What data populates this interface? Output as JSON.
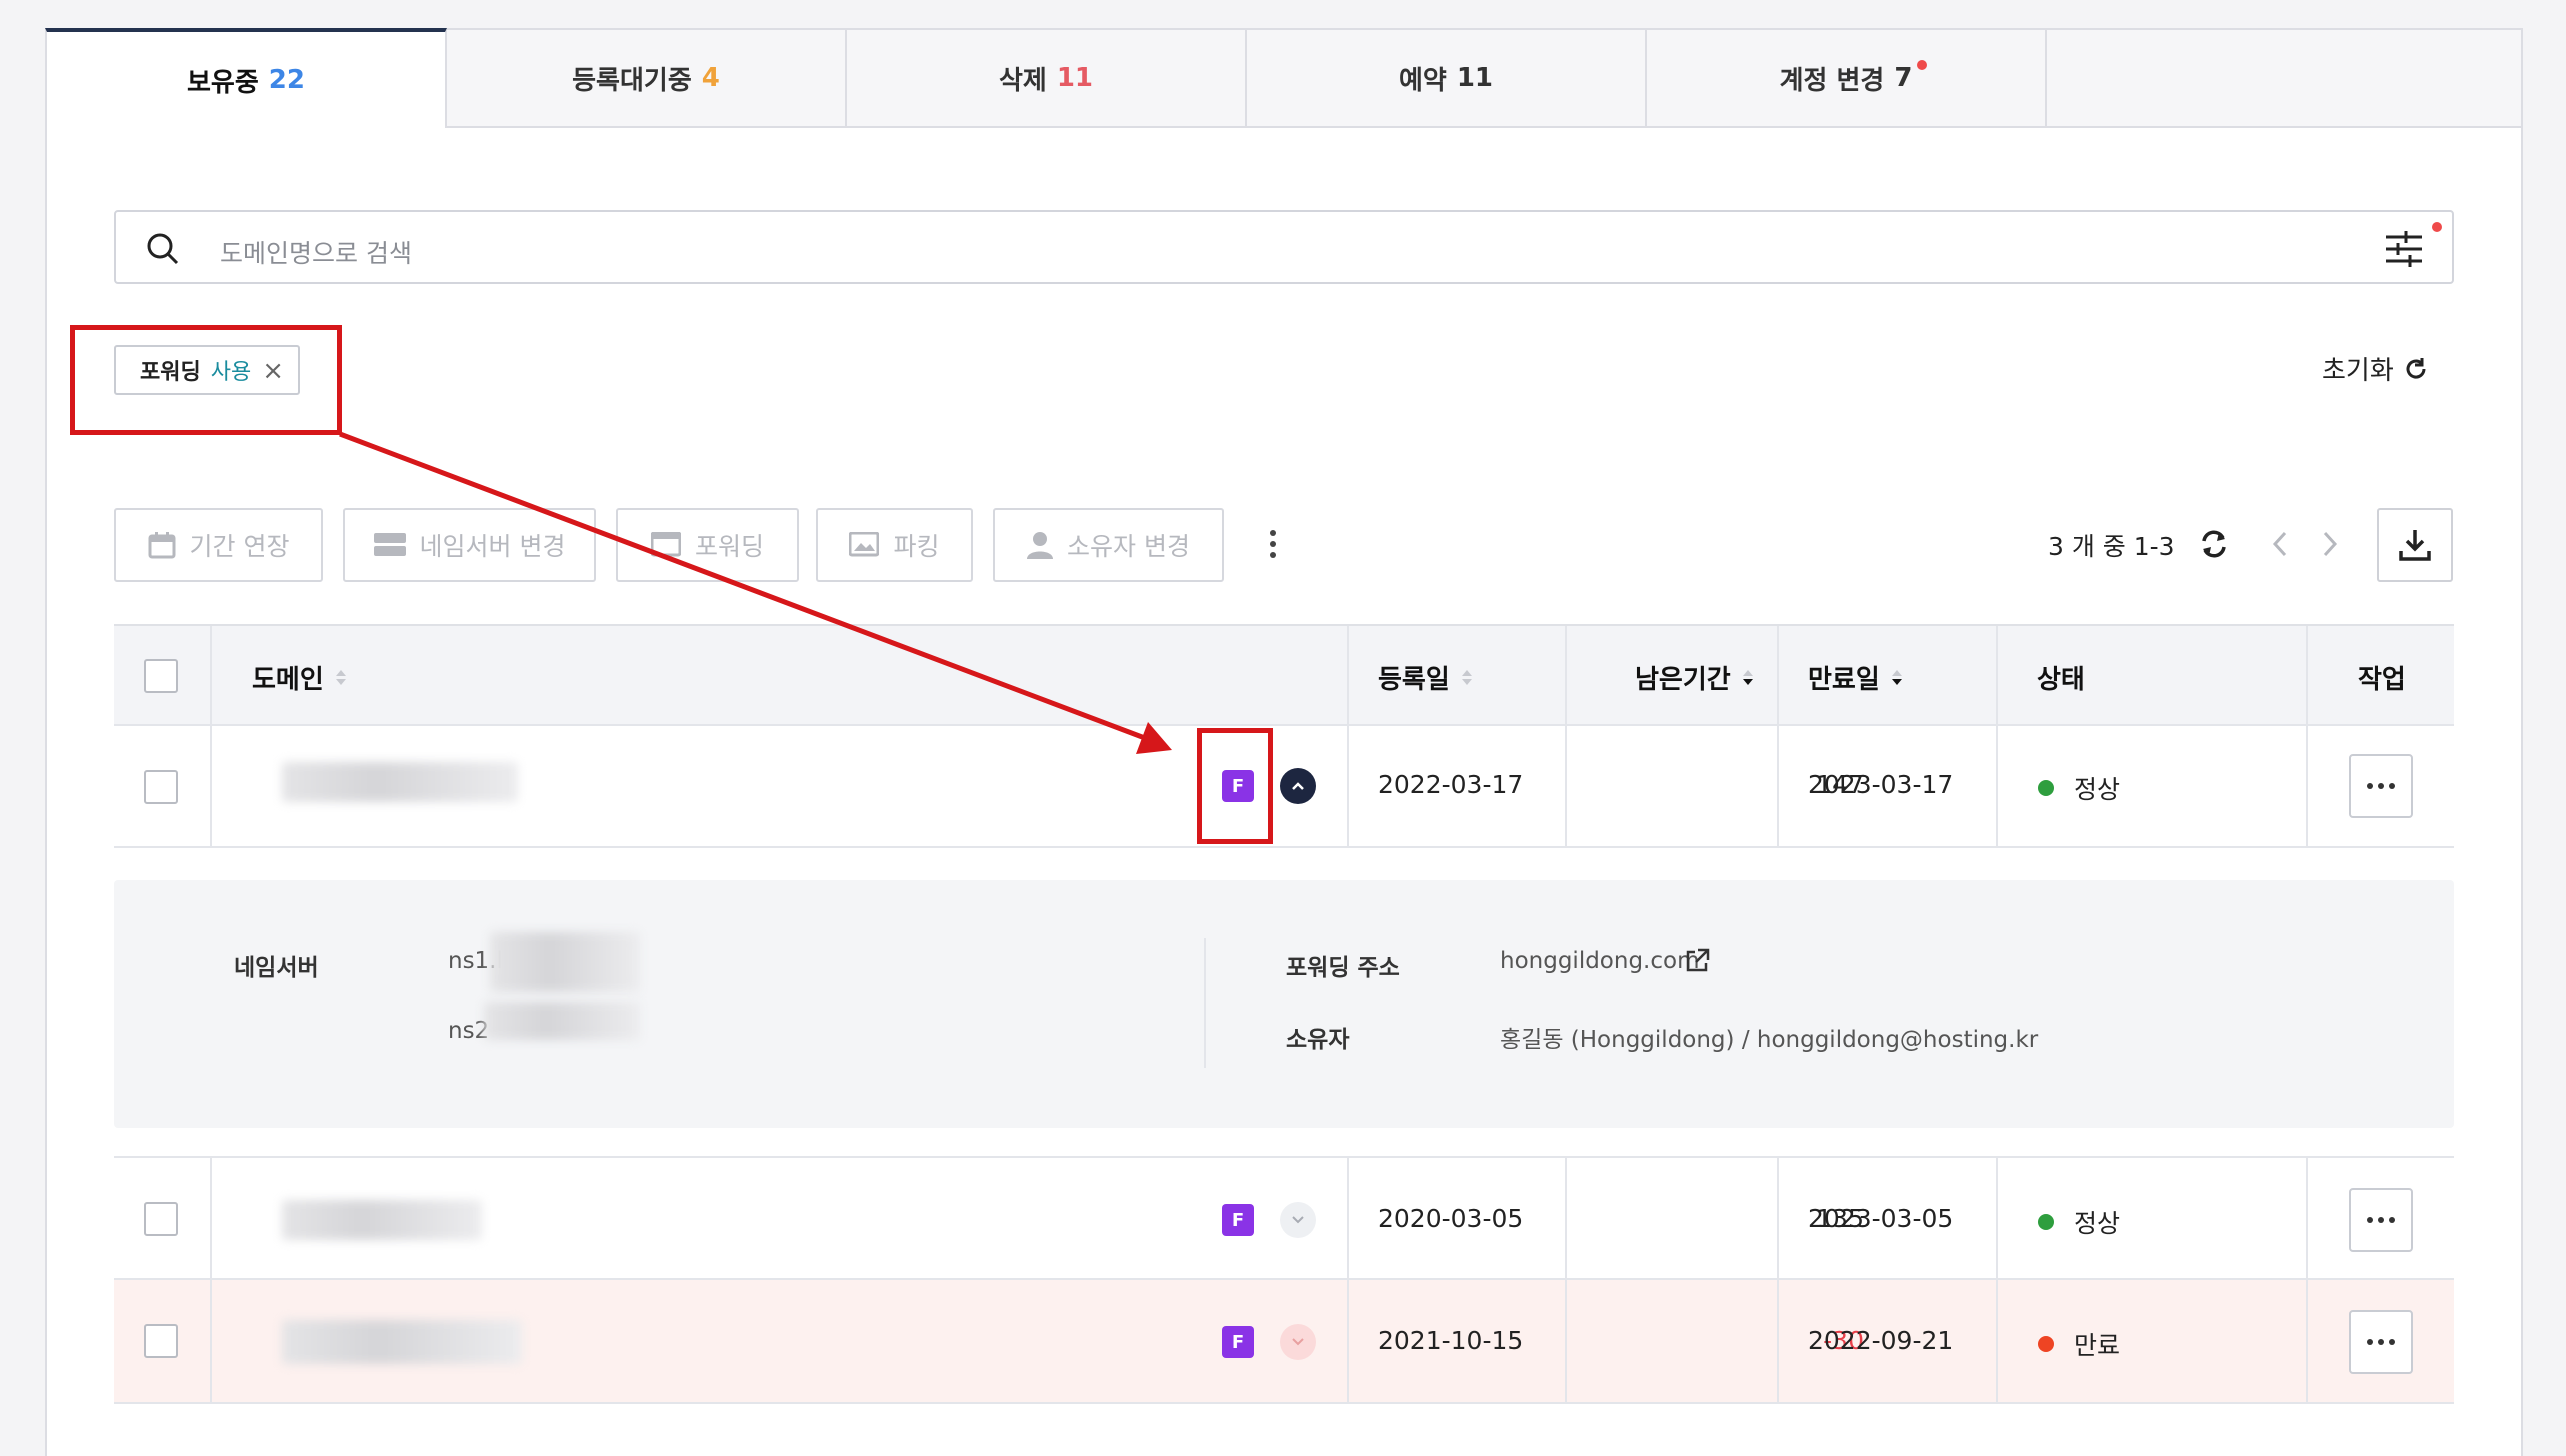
{
  "tabs": [
    {
      "label": "보유중",
      "count": "22"
    },
    {
      "label": "등록대기중",
      "count": "4"
    },
    {
      "label": "삭제",
      "count": "11"
    },
    {
      "label": "예약",
      "count": "11"
    },
    {
      "label": "계정 변경",
      "count": "7"
    }
  ],
  "search": {
    "placeholder": "도메인명으로 검색"
  },
  "filter_chip": {
    "key": "포워딩",
    "value": "사용"
  },
  "reset_label": "초기화",
  "toolbar": {
    "extend": "기간 연장",
    "nameserver": "네임서버 변경",
    "forwarding": "포워딩",
    "parking": "파킹",
    "owner": "소유자 변경"
  },
  "pagination": {
    "summary": "3 개 중 1-3"
  },
  "table": {
    "headers": {
      "domain": "도메인",
      "registered": "등록일",
      "remaining": "남은기간",
      "expires": "만료일",
      "status": "상태",
      "action": "작업"
    },
    "rows": [
      {
        "registered": "2022-03-17",
        "remaining": "147",
        "expires": "2023-03-17",
        "status": "정상",
        "badge": "F"
      },
      {
        "registered": "2020-03-05",
        "remaining": "135",
        "expires": "2023-03-05",
        "status": "정상",
        "badge": "F"
      },
      {
        "registered": "2021-10-15",
        "remaining": "-30",
        "expires": "2022-09-21",
        "status": "만료",
        "badge": "F"
      }
    ]
  },
  "detail": {
    "ns_label": "네임서버",
    "ns1": "ns1.l",
    "ns2": "ns2",
    "forward_label": "포워딩 주소",
    "forward_value": "honggildong.com",
    "owner_label": "소유자",
    "owner_value": "홍길동 (Honggildong) / honggildong@hosting.kr"
  },
  "colors": {
    "accent": "#3d86e6",
    "badge": "#8a33e6",
    "ok": "#2e9e3e",
    "expired": "#ee4423",
    "expired_row": "#fdf1ef",
    "annotation": "#d6171a"
  }
}
